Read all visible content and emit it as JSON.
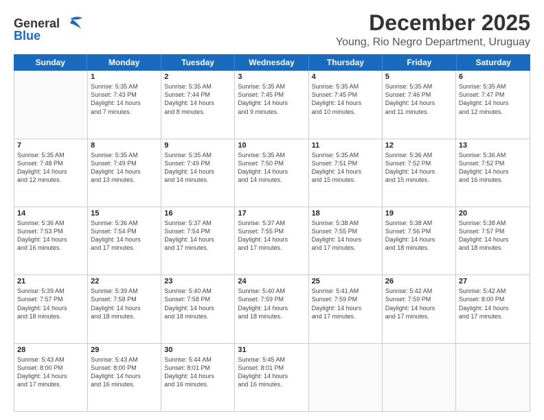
{
  "logo": {
    "line1": "General",
    "line2": "Blue"
  },
  "title": "December 2025",
  "subtitle": "Young, Rio Negro Department, Uruguay",
  "header_days": [
    "Sunday",
    "Monday",
    "Tuesday",
    "Wednesday",
    "Thursday",
    "Friday",
    "Saturday"
  ],
  "weeks": [
    [
      {
        "day": "",
        "sunrise": "",
        "sunset": "",
        "daylight": "",
        "daylight2": ""
      },
      {
        "day": "1",
        "sunrise": "Sunrise: 5:35 AM",
        "sunset": "Sunset: 7:43 PM",
        "daylight": "Daylight: 14 hours",
        "daylight2": "and 7 minutes."
      },
      {
        "day": "2",
        "sunrise": "Sunrise: 5:35 AM",
        "sunset": "Sunset: 7:44 PM",
        "daylight": "Daylight: 14 hours",
        "daylight2": "and 8 minutes."
      },
      {
        "day": "3",
        "sunrise": "Sunrise: 5:35 AM",
        "sunset": "Sunset: 7:45 PM",
        "daylight": "Daylight: 14 hours",
        "daylight2": "and 9 minutes."
      },
      {
        "day": "4",
        "sunrise": "Sunrise: 5:35 AM",
        "sunset": "Sunset: 7:45 PM",
        "daylight": "Daylight: 14 hours",
        "daylight2": "and 10 minutes."
      },
      {
        "day": "5",
        "sunrise": "Sunrise: 5:35 AM",
        "sunset": "Sunset: 7:46 PM",
        "daylight": "Daylight: 14 hours",
        "daylight2": "and 11 minutes."
      },
      {
        "day": "6",
        "sunrise": "Sunrise: 5:35 AM",
        "sunset": "Sunset: 7:47 PM",
        "daylight": "Daylight: 14 hours",
        "daylight2": "and 12 minutes."
      }
    ],
    [
      {
        "day": "7",
        "sunrise": "Sunrise: 5:35 AM",
        "sunset": "Sunset: 7:48 PM",
        "daylight": "Daylight: 14 hours",
        "daylight2": "and 12 minutes."
      },
      {
        "day": "8",
        "sunrise": "Sunrise: 5:35 AM",
        "sunset": "Sunset: 7:49 PM",
        "daylight": "Daylight: 14 hours",
        "daylight2": "and 13 minutes."
      },
      {
        "day": "9",
        "sunrise": "Sunrise: 5:35 AM",
        "sunset": "Sunset: 7:49 PM",
        "daylight": "Daylight: 14 hours",
        "daylight2": "and 14 minutes."
      },
      {
        "day": "10",
        "sunrise": "Sunrise: 5:35 AM",
        "sunset": "Sunset: 7:50 PM",
        "daylight": "Daylight: 14 hours",
        "daylight2": "and 14 minutes."
      },
      {
        "day": "11",
        "sunrise": "Sunrise: 5:35 AM",
        "sunset": "Sunset: 7:51 PM",
        "daylight": "Daylight: 14 hours",
        "daylight2": "and 15 minutes."
      },
      {
        "day": "12",
        "sunrise": "Sunrise: 5:36 AM",
        "sunset": "Sunset: 7:52 PM",
        "daylight": "Daylight: 14 hours",
        "daylight2": "and 15 minutes."
      },
      {
        "day": "13",
        "sunrise": "Sunrise: 5:36 AM",
        "sunset": "Sunset: 7:52 PM",
        "daylight": "Daylight: 14 hours",
        "daylight2": "and 16 minutes."
      }
    ],
    [
      {
        "day": "14",
        "sunrise": "Sunrise: 5:36 AM",
        "sunset": "Sunset: 7:53 PM",
        "daylight": "Daylight: 14 hours",
        "daylight2": "and 16 minutes."
      },
      {
        "day": "15",
        "sunrise": "Sunrise: 5:36 AM",
        "sunset": "Sunset: 7:54 PM",
        "daylight": "Daylight: 14 hours",
        "daylight2": "and 17 minutes."
      },
      {
        "day": "16",
        "sunrise": "Sunrise: 5:37 AM",
        "sunset": "Sunset: 7:54 PM",
        "daylight": "Daylight: 14 hours",
        "daylight2": "and 17 minutes."
      },
      {
        "day": "17",
        "sunrise": "Sunrise: 5:37 AM",
        "sunset": "Sunset: 7:55 PM",
        "daylight": "Daylight: 14 hours",
        "daylight2": "and 17 minutes."
      },
      {
        "day": "18",
        "sunrise": "Sunrise: 5:38 AM",
        "sunset": "Sunset: 7:55 PM",
        "daylight": "Daylight: 14 hours",
        "daylight2": "and 17 minutes."
      },
      {
        "day": "19",
        "sunrise": "Sunrise: 5:38 AM",
        "sunset": "Sunset: 7:56 PM",
        "daylight": "Daylight: 14 hours",
        "daylight2": "and 18 minutes."
      },
      {
        "day": "20",
        "sunrise": "Sunrise: 5:38 AM",
        "sunset": "Sunset: 7:57 PM",
        "daylight": "Daylight: 14 hours",
        "daylight2": "and 18 minutes."
      }
    ],
    [
      {
        "day": "21",
        "sunrise": "Sunrise: 5:39 AM",
        "sunset": "Sunset: 7:57 PM",
        "daylight": "Daylight: 14 hours",
        "daylight2": "and 18 minutes."
      },
      {
        "day": "22",
        "sunrise": "Sunrise: 5:39 AM",
        "sunset": "Sunset: 7:58 PM",
        "daylight": "Daylight: 14 hours",
        "daylight2": "and 18 minutes."
      },
      {
        "day": "23",
        "sunrise": "Sunrise: 5:40 AM",
        "sunset": "Sunset: 7:58 PM",
        "daylight": "Daylight: 14 hours",
        "daylight2": "and 18 minutes."
      },
      {
        "day": "24",
        "sunrise": "Sunrise: 5:40 AM",
        "sunset": "Sunset: 7:59 PM",
        "daylight": "Daylight: 14 hours",
        "daylight2": "and 18 minutes."
      },
      {
        "day": "25",
        "sunrise": "Sunrise: 5:41 AM",
        "sunset": "Sunset: 7:59 PM",
        "daylight": "Daylight: 14 hours",
        "daylight2": "and 17 minutes."
      },
      {
        "day": "26",
        "sunrise": "Sunrise: 5:42 AM",
        "sunset": "Sunset: 7:59 PM",
        "daylight": "Daylight: 14 hours",
        "daylight2": "and 17 minutes."
      },
      {
        "day": "27",
        "sunrise": "Sunrise: 5:42 AM",
        "sunset": "Sunset: 8:00 PM",
        "daylight": "Daylight: 14 hours",
        "daylight2": "and 17 minutes."
      }
    ],
    [
      {
        "day": "28",
        "sunrise": "Sunrise: 5:43 AM",
        "sunset": "Sunset: 8:00 PM",
        "daylight": "Daylight: 14 hours",
        "daylight2": "and 17 minutes."
      },
      {
        "day": "29",
        "sunrise": "Sunrise: 5:43 AM",
        "sunset": "Sunset: 8:00 PM",
        "daylight": "Daylight: 14 hours",
        "daylight2": "and 16 minutes."
      },
      {
        "day": "30",
        "sunrise": "Sunrise: 5:44 AM",
        "sunset": "Sunset: 8:01 PM",
        "daylight": "Daylight: 14 hours",
        "daylight2": "and 16 minutes."
      },
      {
        "day": "31",
        "sunrise": "Sunrise: 5:45 AM",
        "sunset": "Sunset: 8:01 PM",
        "daylight": "Daylight: 14 hours",
        "daylight2": "and 16 minutes."
      },
      {
        "day": "",
        "sunrise": "",
        "sunset": "",
        "daylight": "",
        "daylight2": ""
      },
      {
        "day": "",
        "sunrise": "",
        "sunset": "",
        "daylight": "",
        "daylight2": ""
      },
      {
        "day": "",
        "sunrise": "",
        "sunset": "",
        "daylight": "",
        "daylight2": ""
      }
    ]
  ]
}
